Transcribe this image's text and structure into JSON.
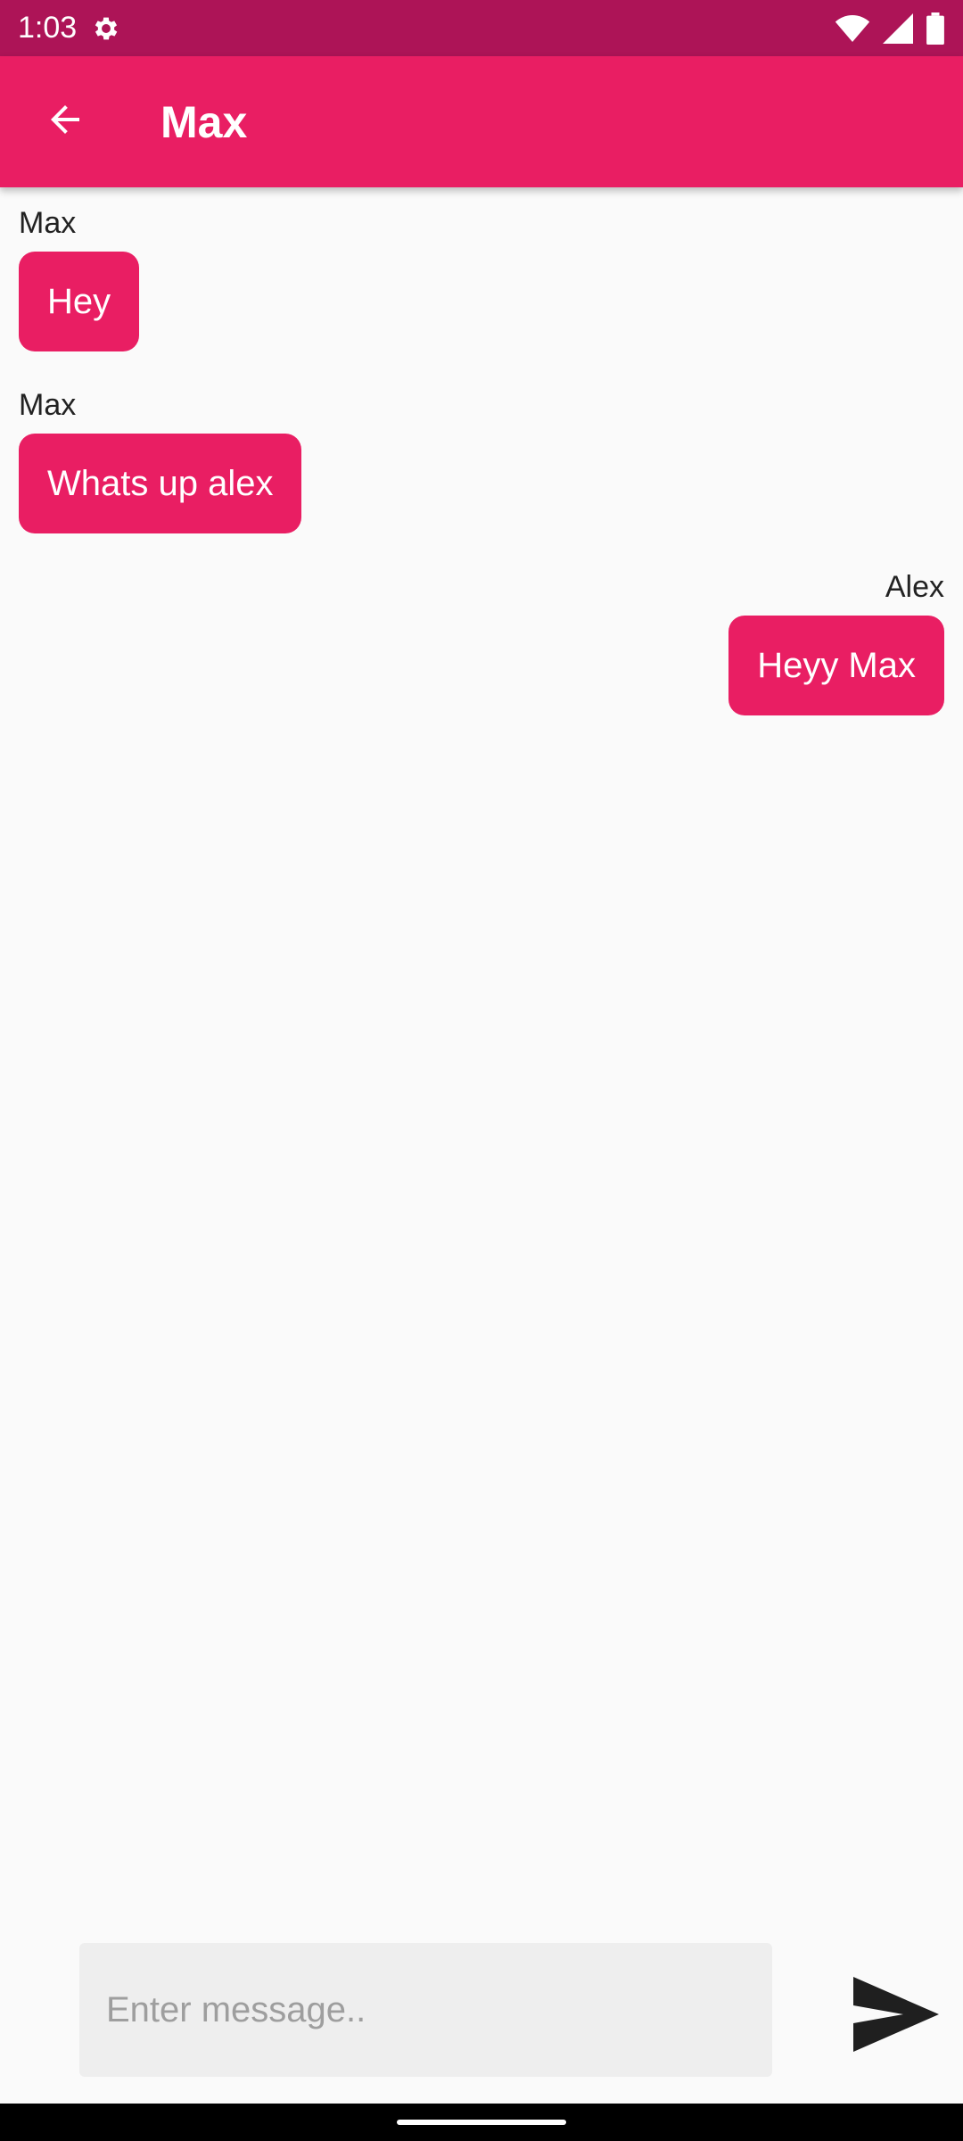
{
  "status_bar": {
    "time": "1:03",
    "icons": [
      "gear-icon",
      "wifi-icon",
      "signal-icon",
      "battery-icon"
    ]
  },
  "app_bar": {
    "title": "Max",
    "back_icon": "arrow-back-icon"
  },
  "messages": [
    {
      "sender": "Max",
      "text": "Hey",
      "direction": "incoming"
    },
    {
      "sender": "Max",
      "text": "Whats up alex",
      "direction": "incoming"
    },
    {
      "sender": "Alex",
      "text": "Heyy Max",
      "direction": "outgoing"
    }
  ],
  "composer": {
    "placeholder": "Enter message..",
    "value": "",
    "send_icon": "send-icon"
  },
  "colors": {
    "status_bar": "#ad1457",
    "primary": "#e91e63",
    "background": "#fafafa",
    "input_background": "#eeeeee"
  }
}
